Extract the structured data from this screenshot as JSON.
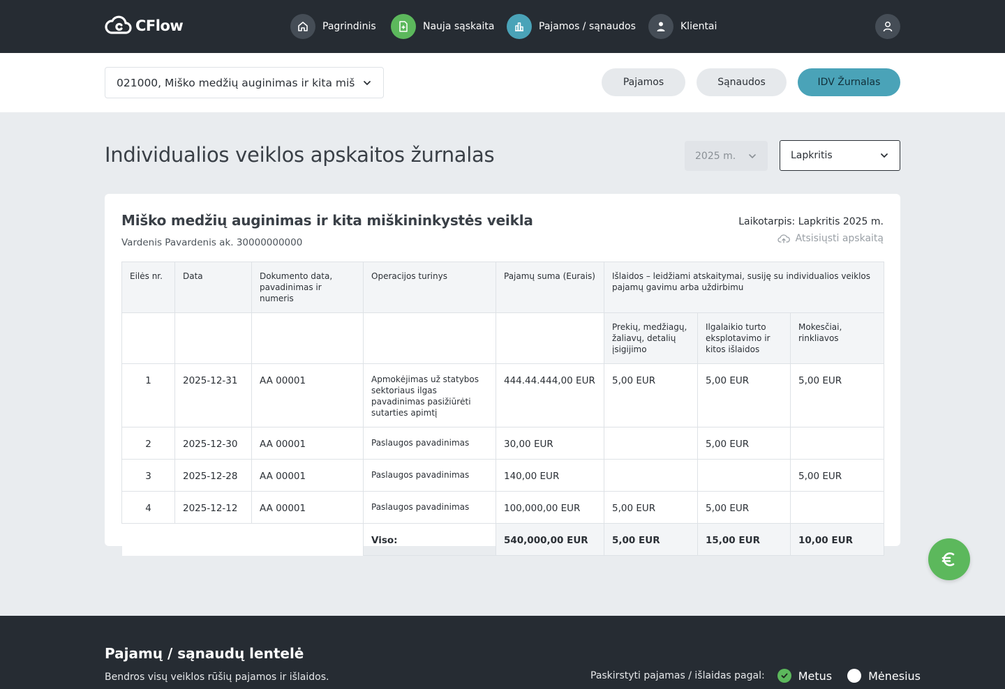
{
  "app": {
    "logo_text": "CFlow"
  },
  "nav": {
    "items": [
      {
        "label": "Pagrindinis",
        "icon": "home-icon"
      },
      {
        "label": "Nauja sąskaita",
        "icon": "new-invoice-icon"
      },
      {
        "label": "Pajamos / sąnaudos",
        "icon": "bar-chart-icon"
      },
      {
        "label": "Klientai",
        "icon": "person-icon"
      }
    ],
    "user_icon": "user-icon"
  },
  "subheader": {
    "activity_selected": "021000, Miško medžių auginimas ir kita mišk",
    "tabs": [
      {
        "label": "Pajamos",
        "active": false
      },
      {
        "label": "Sąnaudos",
        "active": false
      },
      {
        "label": "IDV Žurnalas",
        "active": true
      }
    ]
  },
  "page": {
    "title": "Individualios veiklos apskaitos žurnalas",
    "year": "2025 m.",
    "month": "Lapkritis"
  },
  "card": {
    "title": "Miško medžių auginimas ir kita miškininkystės veikla",
    "subtitle": "Vardenis Pavardenis ak. 30000000000",
    "period": "Laikotarpis: Lapkritis 2025 m.",
    "download_label": "Atsisiųsti apskaitą"
  },
  "table": {
    "headers": {
      "eil": "Eilės nr.",
      "data": "Data",
      "doc": "Dokumento data, pavadinimas ir numeris",
      "op": "Operacijos turinys",
      "income": "Pajamų suma (Eurais)",
      "expenses": "Išlaidos – leidžiami atskaitymai, susiję su individualios veiklos pajamų gavimu arba uždirbimu",
      "exp1": "Prekių, medžiagų, žaliavų, detalių įsigijimo",
      "exp2": "Ilgalaikio turto eksplotavimo ir kitos išlaidos",
      "exp3": "Mokesčiai, rinkliavos"
    },
    "rows": [
      {
        "nr": "1",
        "date": "2025-12-31",
        "doc": "AA 00001",
        "op": "Apmokėjimas už statybos sektoriaus ilgas pavadinimas pasižiūrėti sutarties apimtį",
        "income": "444.44.444,00 EUR",
        "exp1": "5,00 EUR",
        "exp2": "5,00 EUR",
        "exp3": "5,00 EUR"
      },
      {
        "nr": "2",
        "date": "2025-12-30",
        "doc": "AA 00001",
        "op": "Paslaugos pavadinimas",
        "income": "30,00 EUR",
        "exp1": "",
        "exp2": "5,00 EUR",
        "exp3": ""
      },
      {
        "nr": "3",
        "date": "2025-12-28",
        "doc": "AA 00001",
        "op": "Paslaugos pavadinimas",
        "income": "140,00 EUR",
        "exp1": "",
        "exp2": "",
        "exp3": "5,00 EUR"
      },
      {
        "nr": "4",
        "date": "2025-12-12",
        "doc": "AA 00001",
        "op": "Paslaugos pavadinimas",
        "income": "100,000,00 EUR",
        "exp1": "5,00 EUR",
        "exp2": "5,00 EUR",
        "exp3": ""
      }
    ],
    "totals": {
      "label": "Viso:",
      "income": "540,000,00 EUR",
      "exp1": "5,00 EUR",
      "exp2": "15,00 EUR",
      "exp3": "10,00 EUR"
    }
  },
  "fab": {
    "icon": "euro-icon"
  },
  "footer": {
    "title": "Pajamų / sąnaudų lentelė",
    "subtitle": "Bendros visų veiklos rūšių pajamos ir išlaidos.",
    "distribute_label": "Paskirstyti pajamas / išlaidas pagal:",
    "options": [
      {
        "label": "Metus",
        "selected": true
      },
      {
        "label": "Mėnesius",
        "selected": false
      }
    ]
  },
  "colors": {
    "topbar": "#262c33",
    "accent_blue": "#4aa3b8",
    "accent_green": "#5cb85c",
    "page_bg": "#e9ecef"
  }
}
